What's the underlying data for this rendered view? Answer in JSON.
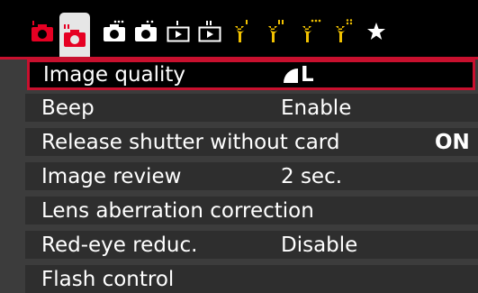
{
  "tabs": [
    {
      "icon": "camera-shooting-1-icon",
      "badge": "1",
      "active": false
    },
    {
      "icon": "camera-shooting-2-icon",
      "badge": "2",
      "active": true
    },
    {
      "icon": "camera-shooting-3-icon",
      "badge": "3",
      "active": false
    },
    {
      "icon": "camera-shooting-4-icon",
      "badge": "4",
      "active": false
    },
    {
      "icon": "playback-1-icon",
      "badge": "1",
      "active": false
    },
    {
      "icon": "playback-2-icon",
      "badge": "2",
      "active": false
    },
    {
      "icon": "setup-wrench-1-icon",
      "badge": "1",
      "active": false
    },
    {
      "icon": "setup-wrench-2-icon",
      "badge": "2",
      "active": false
    },
    {
      "icon": "setup-wrench-3-icon",
      "badge": "3",
      "active": false
    },
    {
      "icon": "setup-wrench-4-icon",
      "badge": "4",
      "active": false
    },
    {
      "icon": "my-menu-star-icon",
      "badge": "",
      "active": false
    }
  ],
  "menu": {
    "items": [
      {
        "label": "Image quality",
        "value": "L",
        "value_icon": "large-fine-quality-icon",
        "selected": true
      },
      {
        "label": "Beep",
        "value": "Enable",
        "selected": false
      },
      {
        "label": "Release shutter without card",
        "value": "ON",
        "selected": false
      },
      {
        "label": "Image review",
        "value": "2 sec.",
        "selected": false
      },
      {
        "label": "Lens aberration correction",
        "value": "",
        "selected": false
      },
      {
        "label": "Red-eye reduc.",
        "value": "Disable",
        "selected": false
      },
      {
        "label": "Flash control",
        "value": "",
        "selected": false
      }
    ]
  },
  "colors": {
    "accent_red": "#c8102e",
    "row_bg": "#2e2e2e",
    "active_tab_bg": "#e6e6e6",
    "camera_tab_icon": "#e60023",
    "wrench_tab_icon": "#f2c200"
  }
}
